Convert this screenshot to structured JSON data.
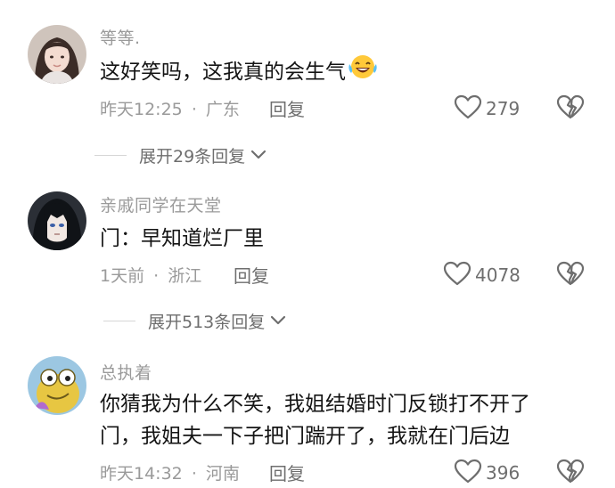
{
  "comments": [
    {
      "username": "等等.",
      "text": "这好笑吗，这我真的会生气",
      "emoji": "laughing-crying-emoji",
      "time": "昨天12:25",
      "separator": "·",
      "location": "广东",
      "reply_label": "回复",
      "likes": "279",
      "expand_label": "展开29条回复"
    },
    {
      "username": "亲戚同学在天堂",
      "text": "门：早知道烂厂里",
      "time": "1天前",
      "separator": "·",
      "location": "浙江",
      "reply_label": "回复",
      "likes": "4078",
      "expand_label": "展开513条回复"
    },
    {
      "username": "总执着",
      "text_line1": "你猜我为什么不笑，我姐结婚时门反锁打不开了",
      "text_line2": "门，我姐夫一下子把门踹开了，我就在门后边",
      "time": "昨天14:32",
      "separator": "·",
      "location": "河南",
      "reply_label": "回复",
      "likes": "396"
    }
  ],
  "colors": {
    "text_primary": "#141414",
    "text_secondary": "#9a9a9a",
    "icon_gray": "#6e6e6e"
  }
}
